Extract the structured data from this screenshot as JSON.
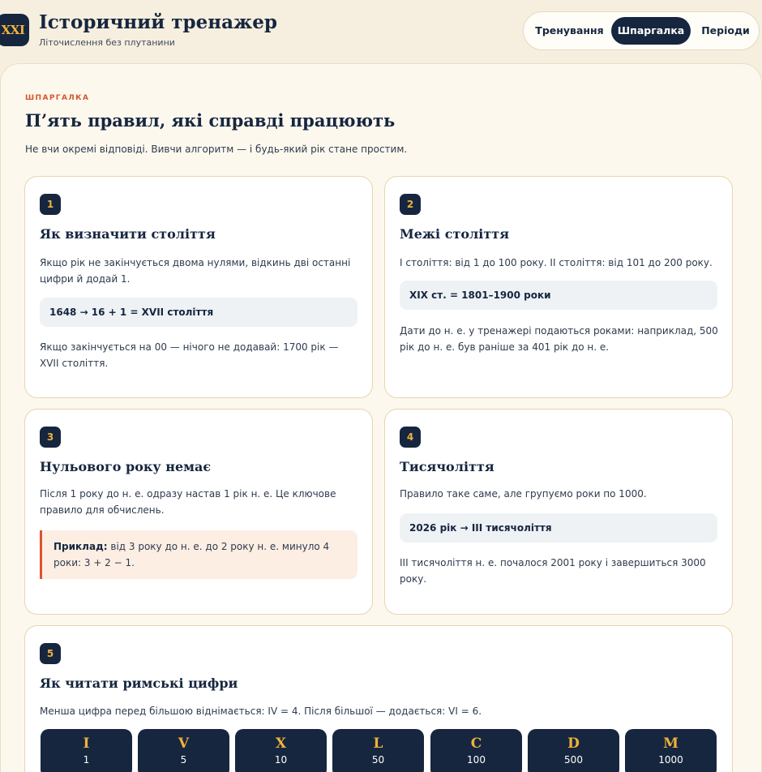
{
  "header": {
    "logo": "XXI",
    "title": "Історичний тренажер",
    "subtitle": "Літочислення без плутанини"
  },
  "nav": {
    "items": [
      {
        "label": "Тренування",
        "active": false
      },
      {
        "label": "Шпаргалка",
        "active": true
      },
      {
        "label": "Періоди",
        "active": false
      }
    ]
  },
  "page": {
    "eyebrow": "ШПАРГАЛКА",
    "title": "П’ять правил, які справді працюють",
    "lead": "Не вчи окремі відповіді. Вивчи алгоритм — і будь-який рік стане простим."
  },
  "rules": [
    {
      "number": "1",
      "title": "Як визначити століття",
      "text": "Якщо рік не закінчується двома нулями, відкинь дві останні цифри й додай 1.",
      "formula": "1648 → 16 + 1 = XVII століття",
      "note": "Якщо закінчується на 00 — нічого не додавай: 1700 рік — XVII століття."
    },
    {
      "number": "2",
      "title": "Межі століття",
      "text": "І століття: від 1 до 100 року. ІІ століття: від 101 до 200 року.",
      "formula": "XIX ст. = 1801–1900 роки",
      "note": "Дати до н. е. у тренажері подаються роками: наприклад, 500 рік до н. е. був раніше за 401 рік до н. е."
    },
    {
      "number": "3",
      "title": "Нульового року немає",
      "text": "Після 1 року до н. е. одразу настав 1 рік н. е. Це ключове правило для обчислень.",
      "example_label": "Приклад:",
      "example_text": " від 3 року до н. е. до 2 року н. е. минуло 4 роки: 3 + 2 − 1."
    },
    {
      "number": "4",
      "title": "Тисячоліття",
      "text": "Правило таке саме, але групуємо роки по 1000.",
      "formula": "2026 рік → ІІІ тисячоліття",
      "note": "ІІІ тисячоліття н. е. почалося 2001 року і завершиться 3000 року."
    },
    {
      "number": "5",
      "title": "Як читати римські цифри",
      "text": "Менша цифра перед більшою віднімається: IV = 4. Після більшої — додається: VI = 6."
    }
  ],
  "numerals": [
    {
      "letter": "I",
      "value": "1"
    },
    {
      "letter": "V",
      "value": "5"
    },
    {
      "letter": "X",
      "value": "10"
    },
    {
      "letter": "L",
      "value": "50"
    },
    {
      "letter": "C",
      "value": "100"
    },
    {
      "letter": "D",
      "value": "500"
    },
    {
      "letter": "M",
      "value": "1000"
    }
  ]
}
